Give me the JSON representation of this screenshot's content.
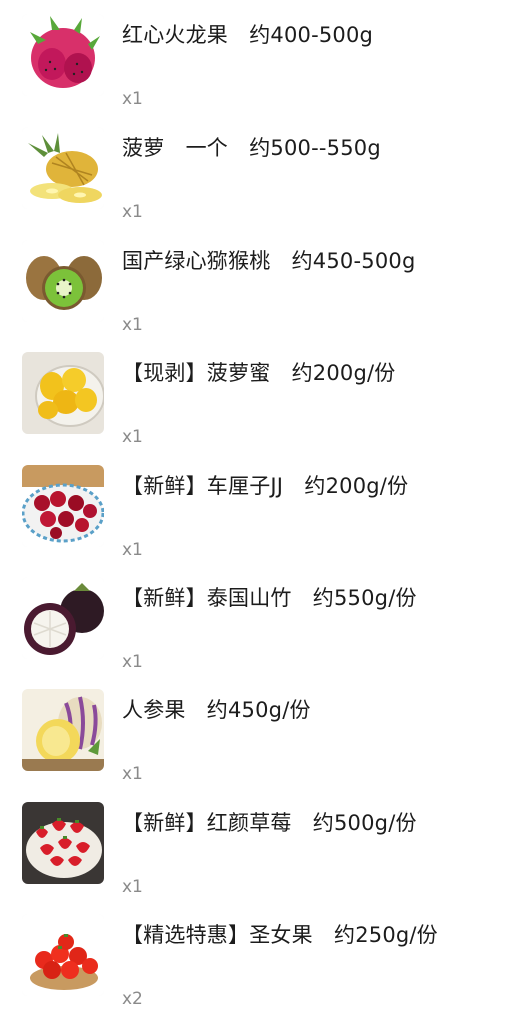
{
  "items": [
    {
      "title": "红心火龙果　约400-500g",
      "qty": "x1",
      "image": "dragon-fruit-image"
    },
    {
      "title": "菠萝　一个　约500--550g",
      "qty": "x1",
      "image": "pineapple-image"
    },
    {
      "title": "国产绿心猕猴桃　约450-500g",
      "qty": "x1",
      "image": "kiwi-image"
    },
    {
      "title": "【现剥】菠萝蜜　约200g/份",
      "qty": "x1",
      "image": "jackfruit-image"
    },
    {
      "title": "【新鲜】车厘子JJ　约200g/份",
      "qty": "x1",
      "image": "cherry-image"
    },
    {
      "title": "【新鲜】泰国山竹　约550g/份",
      "qty": "x1",
      "image": "mangosteen-image"
    },
    {
      "title": "人参果　约450g/份",
      "qty": "x1",
      "image": "pepino-image"
    },
    {
      "title": "【新鲜】红颜草莓　约500g/份",
      "qty": "x1",
      "image": "strawberry-image"
    },
    {
      "title": "【精选特惠】圣女果　约250g/份",
      "qty": "x2",
      "image": "cherry-tomato-image"
    }
  ]
}
